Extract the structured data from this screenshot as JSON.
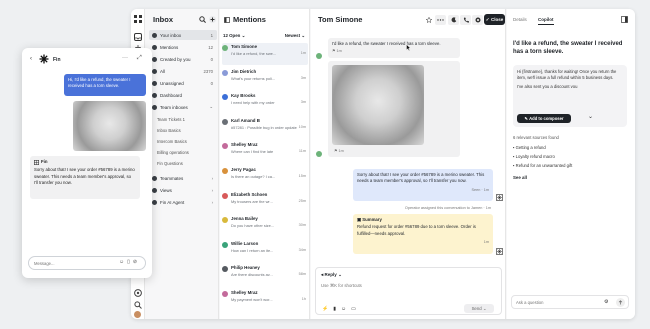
{
  "rail": {
    "icons": [
      "app-grid-icon",
      "inbox-icon",
      "robot-icon",
      "chart-icon",
      "contacts-icon",
      "apps-icon",
      "help-icon",
      "search-icon",
      "user-avatar"
    ]
  },
  "inbox_nav": {
    "title": "Inbox",
    "items": [
      {
        "icon": "your-inbox-icon",
        "label": "Your inbox",
        "count": "1"
      },
      {
        "icon": "mentions-icon",
        "label": "Mentions",
        "count": "12"
      },
      {
        "icon": "created-by-you-icon",
        "label": "Created by you",
        "count": "0"
      },
      {
        "icon": "all-icon",
        "label": "All",
        "count": "2370"
      },
      {
        "icon": "unassigned-icon",
        "label": "Unassigned",
        "count": "0"
      },
      {
        "icon": "dashboard-icon",
        "label": "Dashboard",
        "count": ""
      },
      {
        "icon": "team-inboxes-icon",
        "label": "Team inboxes",
        "count": ""
      }
    ],
    "team_inboxes": [
      "Team Tickets 1",
      "Inbox Basics",
      "Intercom Basics",
      "Billing operations",
      "Fin Questions"
    ],
    "bottom_items": [
      {
        "label": "Teammates"
      },
      {
        "label": "Views"
      },
      {
        "label": "Fin AI Agent"
      }
    ]
  },
  "mentions": {
    "title": "Mentions",
    "filter_open": "12 Open",
    "sort": "Newest",
    "rows": [
      {
        "name": "Tom Simone",
        "preview": "I'd like a refund, the swe...",
        "time": "1m",
        "color": "#6db37a"
      },
      {
        "name": "Jim Dietrich",
        "preview": "What's your returns poli...",
        "time": "3m",
        "color": "#8a9bd8"
      },
      {
        "name": "Kay Brooks",
        "preview": "I need help with my order",
        "time": "3m",
        "color": "#3b6fd8"
      },
      {
        "name": "Karl Amand B",
        "preview": "#57281 : Possible bug in order update screen no...",
        "time": "10m",
        "color": "#6a6f76"
      },
      {
        "name": "Shelley Mraz",
        "preview": "Where can I find the late",
        "time": "11m",
        "color": "#c36a9b"
      },
      {
        "name": "Jerry Pagac",
        "preview": "Is there an outage? I ca...",
        "time": "15m",
        "color": "#d8913b"
      },
      {
        "name": "Elizabeth Schoen",
        "preview": "My trousers are the wr...",
        "time": "25m",
        "color": "#d85a5a"
      },
      {
        "name": "Jenna Bailey",
        "preview": "Do you have other size...",
        "time": "30m",
        "color": "#d8b93b"
      },
      {
        "name": "Willie Larson",
        "preview": "How can I return an ite...",
        "time": "34m",
        "color": "#3aa37a"
      },
      {
        "name": "Philip Heaney",
        "preview": "Are there discounts av...",
        "time": "58m",
        "color": "#555a60"
      },
      {
        "name": "Shelley Mraz",
        "preview": "My payment won't wor...",
        "time": "1h",
        "color": "#c36a9b"
      }
    ]
  },
  "conversation": {
    "title": "Tom Simone",
    "close_label": "Close",
    "customer_msg": "I'd like a refund, the sweater I received has a torn sleeve.",
    "customer_time": "1m",
    "agent_msg": "Sorry about that! I see your order #56789 is a merino sweater. This needs a team member's approval, so I'll transfer you now.",
    "agent_meta": "Seen · 1m",
    "event": "Operator assigned this conversation to Jamen · 1m",
    "summary_title": "Summary",
    "summary_text": "Refund request for order #56789 due to a torn sleeve. Order is fulfilled—needs approval.",
    "summary_time": "1m",
    "reply_label": "Reply",
    "composer_placeholder": "Use ⌘K for shortcuts",
    "send_label": "Send"
  },
  "copilot": {
    "tabs": [
      "Details",
      "Copilot"
    ],
    "question": "I'd like a refund, the sweater I received has a torn sleeve.",
    "answer": "Hi {firstname}, thanks for waiting! Once you return the item, we'll issue a full refund within 5 business days.",
    "answer2": "I've also sent you a discount vou",
    "add_label": "Add to composer",
    "sources_label": "6 relevant sources found",
    "sources": [
      "Getting a refund",
      "Loyalty refund macro",
      "Refund for an unwarranted gift"
    ],
    "see_all": "See all",
    "ask_placeholder": "Ask a question"
  },
  "fin_widget": {
    "title": "Fin",
    "user_msg": "Hi, I'd like a refund, the sweater I received has a torn sleeve.",
    "bot_name": "Fin",
    "bot_msg": "Sorry about that! I see your order #56789 is a merino sweater. This needs a team member's approval, so I'll transfer you now.",
    "placeholder": "Message..."
  },
  "colors": {
    "accent": "#3b6fd8",
    "summary_bg": "#fdf3cf",
    "agent_bubble": "#dfe8fb",
    "user_bubble": "#4a72d9"
  }
}
